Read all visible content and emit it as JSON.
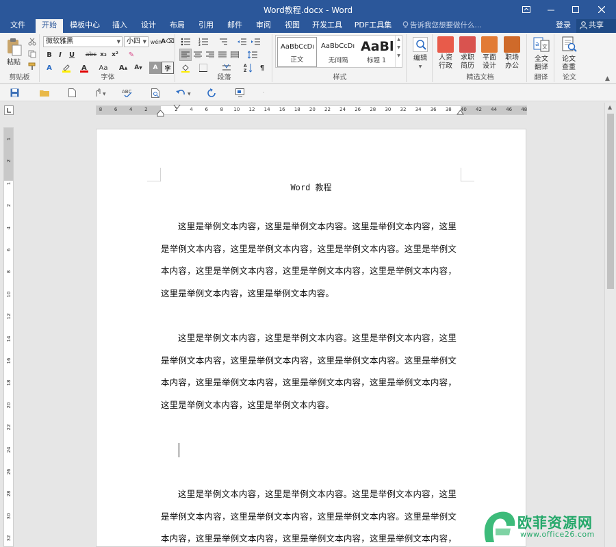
{
  "window": {
    "title": "Word教程.docx - Word"
  },
  "tabs": [
    "文件",
    "开始",
    "模板中心",
    "插入",
    "设计",
    "布局",
    "引用",
    "邮件",
    "审阅",
    "视图",
    "开发工具",
    "PDF工具集"
  ],
  "tell_me": "告诉我您想要做什么...",
  "account": {
    "login": "登录",
    "share": "共享"
  },
  "ribbon": {
    "clipboard": {
      "paste": "粘贴",
      "label": "剪贴板"
    },
    "font": {
      "name": "微软雅黑",
      "size": "小四",
      "label": "字体"
    },
    "paragraph": {
      "label": "段落"
    },
    "styles": {
      "label": "样式",
      "items": [
        {
          "preview": "AaBbCcDı",
          "name": "正文"
        },
        {
          "preview": "AaBbCcDı",
          "name": "无间隔"
        },
        {
          "preview": "AaBl",
          "name": "标题 1"
        }
      ]
    },
    "editing": {
      "label": "编辑"
    },
    "featured": {
      "label": "精选文档",
      "items": [
        {
          "line1": "人资",
          "line2": "行政",
          "color": "#e85b4a"
        },
        {
          "line1": "求职",
          "line2": "简历",
          "color": "#d9534f"
        },
        {
          "line1": "平面",
          "line2": "设计",
          "color": "#e27b35"
        },
        {
          "line1": "职场",
          "line2": "办公",
          "color": "#cf6a2a"
        }
      ]
    },
    "translate": {
      "line1": "全文",
      "line2": "翻译",
      "label": "翻译"
    },
    "paper": {
      "line1": "论文",
      "line2": "查重",
      "label": "论文"
    }
  },
  "ruler_h": [
    "8",
    "6",
    "4",
    "2",
    "",
    "2",
    "4",
    "6",
    "8",
    "10",
    "12",
    "14",
    "16",
    "18",
    "20",
    "22",
    "24",
    "26",
    "28",
    "30",
    "32",
    "34",
    "36",
    "38",
    "40",
    "42",
    "44",
    "46",
    "48"
  ],
  "ruler_v": [
    "1",
    "2",
    "1",
    "2",
    "4",
    "6",
    "8",
    "10",
    "12",
    "14",
    "16",
    "18",
    "20",
    "22",
    "24",
    "26",
    "28",
    "30",
    "32"
  ],
  "document": {
    "header": "Word 教程",
    "paragraphs": [
      "这里是举例文本内容，这里是举例文本内容。这里是举例文本内容，这里是举例文本内容，这里是举例文本内容，这里是举例文本内容。这里是举例文本内容，这里是举例文本内容，这里是举例文本内容，这里是举例文本内容，这里是举例文本内容，这里是举例文本内容。",
      "这里是举例文本内容，这里是举例文本内容。这里是举例文本内容，这里是举例文本内容，这里是举例文本内容，这里是举例文本内容。这里是举例文本内容，这里是举例文本内容，这里是举例文本内容，这里是举例文本内容，这里是举例文本内容，这里是举例文本内容。",
      "这里是举例文本内容，这里是举例文本内容。这里是举例文本内容，这里是举例文本内容，这里是举例文本内容，这里是举例文本内容。这里是举例文本内容，这里是举例文本内容，这里是举例文本内容，这里是举例文本内容，这里是举例文本内容，"
    ]
  },
  "watermark": {
    "name": "欧菲资源网",
    "url": "www.office26.com"
  },
  "colors": {
    "brand": "#2b579a",
    "accent_green": "#25a86a"
  }
}
